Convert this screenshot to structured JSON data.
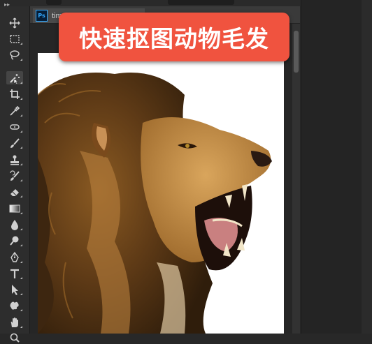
{
  "document": {
    "tab_title": "tim",
    "app_badge": "Ps"
  },
  "overlay": {
    "title": "快速抠图动物毛发"
  },
  "toolbar": {
    "tools": [
      {
        "icon": "move-icon",
        "active": false
      },
      {
        "icon": "marquee-icon",
        "active": false
      },
      {
        "icon": "lasso-icon",
        "active": false
      },
      {
        "icon": "magic-wand-icon",
        "active": true
      },
      {
        "icon": "crop-icon",
        "active": false
      },
      {
        "icon": "eyedropper-icon",
        "active": false
      },
      {
        "icon": "healing-brush-icon",
        "active": false
      },
      {
        "icon": "brush-icon",
        "active": false
      },
      {
        "icon": "clone-stamp-icon",
        "active": false
      },
      {
        "icon": "history-brush-icon",
        "active": false
      },
      {
        "icon": "eraser-icon",
        "active": false
      },
      {
        "icon": "gradient-icon",
        "active": false
      },
      {
        "icon": "blur-icon",
        "active": false
      },
      {
        "icon": "dodge-icon",
        "active": false
      },
      {
        "icon": "pen-icon",
        "active": false
      },
      {
        "icon": "type-icon",
        "active": false
      },
      {
        "icon": "path-selection-icon",
        "active": false
      },
      {
        "icon": "custom-shape-icon",
        "active": false
      },
      {
        "icon": "hand-icon",
        "active": false
      },
      {
        "icon": "zoom-icon",
        "active": false
      }
    ]
  },
  "colors": {
    "banner": "#f0533f",
    "toolbar": "#2d2d2d",
    "workspace": "#262626",
    "accent_ps": "#31a8ff"
  }
}
